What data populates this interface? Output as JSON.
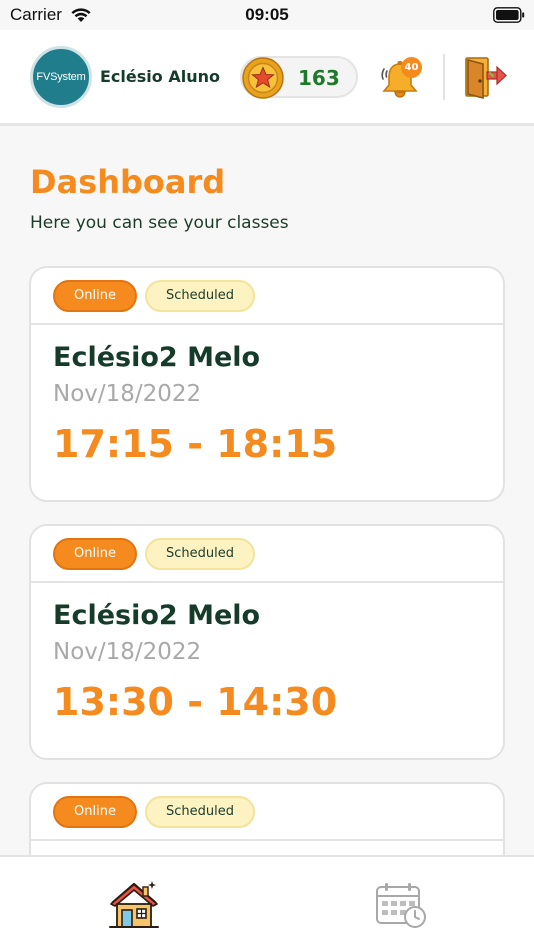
{
  "status_bar": {
    "carrier": "Carrier",
    "time": "09:05"
  },
  "header": {
    "avatar_text": "FVSystem",
    "user_name": "Eclésio Aluno",
    "coins": "163",
    "notification_count": "40"
  },
  "page": {
    "title": "Dashboard",
    "subtitle": "Here you can see your classes"
  },
  "classes": [
    {
      "mode": "Online",
      "status": "Scheduled",
      "teacher": "Eclésio2 Melo",
      "date": "Nov/18/2022",
      "time": "17:15 - 18:15"
    },
    {
      "mode": "Online",
      "status": "Scheduled",
      "teacher": "Eclésio2 Melo",
      "date": "Nov/18/2022",
      "time": "13:30 - 14:30"
    },
    {
      "mode": "Online",
      "status": "Scheduled",
      "teacher": "",
      "date": "",
      "time": ""
    }
  ],
  "tabbar": {
    "items": [
      "home-icon",
      "schedule-calendar-icon"
    ]
  },
  "colors": {
    "accent": "#f58b1f",
    "dark_green": "#163b2a",
    "coin_green": "#1e7a2a",
    "scheduled_bg": "#fdf3c2"
  }
}
